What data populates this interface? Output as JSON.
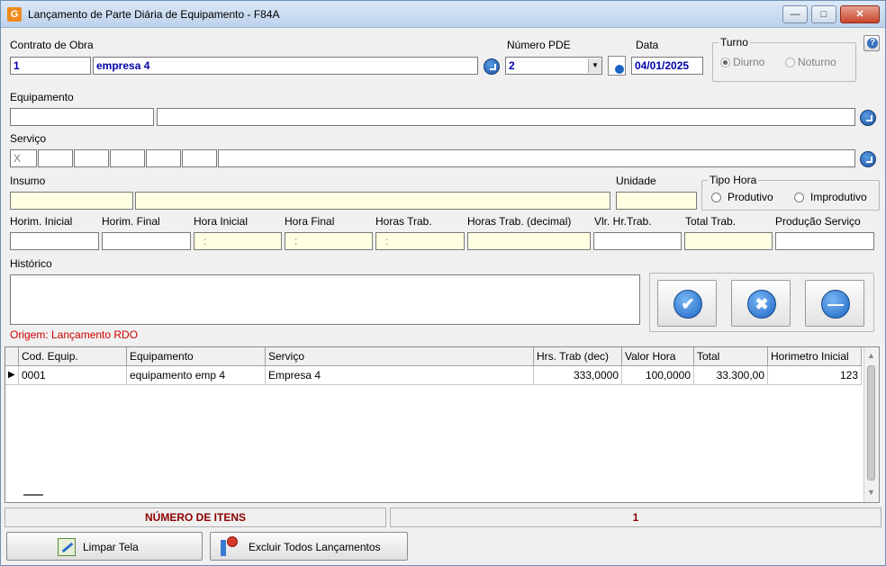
{
  "window": {
    "title": "Lançamento de Parte Diária de Equipamento - F84A",
    "app_icon": "G",
    "controls": {
      "minimize": "—",
      "maximize": "□",
      "close": "✕"
    }
  },
  "header": {
    "contrato_label": "Contrato de Obra",
    "contrato_code": "1",
    "contrato_name": "empresa 4",
    "numero_pde_label": "Número PDE",
    "numero_pde_value": "2",
    "data_label": "Data",
    "data_value": "04/01/2025",
    "turno": {
      "title": "Turno",
      "options": [
        "Diurno",
        "Noturno"
      ],
      "selected": "Diurno"
    }
  },
  "equipamento": {
    "label": "Equipamento",
    "code": "",
    "name": ""
  },
  "servico": {
    "label": "Serviço",
    "first_value": "X"
  },
  "insumo": {
    "label": "Insumo",
    "unidade_label": "Unidade",
    "tipo_hora": {
      "title": "Tipo Hora",
      "options": [
        "Produtivo",
        "Improdutivo"
      ]
    }
  },
  "hours": {
    "labels": [
      "Horim. Inicial",
      "Horim. Final",
      "Hora Inicial",
      "Hora Final",
      "Horas Trab.",
      "Horas Trab. (decimal)",
      "Vlr. Hr.Trab.",
      "Total Trab.",
      "Produção Serviço"
    ],
    "time_placeholder": ":"
  },
  "historico": {
    "label": "Histórico",
    "origem": "Origem: Lançamento RDO"
  },
  "grid": {
    "columns": [
      "Cod. Equip.",
      "Equipamento",
      "Serviço",
      "Hrs. Trab (dec)",
      "Valor Hora",
      "Total",
      "Horimetro Inicial"
    ],
    "rows": [
      [
        "0001",
        "equipamento emp 4",
        "Empresa 4",
        "333,0000",
        "100,0000",
        "33.300,00",
        "123"
      ]
    ]
  },
  "status": {
    "label": "NÚMERO DE ITENS",
    "count": "1"
  },
  "buttons": {
    "limpar": "Limpar Tela",
    "excluir": "Excluir Todos Lançamentos",
    "confirm_glyph": "✔",
    "cancel_glyph": "✖",
    "remove_glyph": "—"
  },
  "colors": {
    "accent_blue": "#1a63c2",
    "origin_red": "#d00000",
    "status_red": "#8b0000",
    "yellow_field": "#ffffe1"
  }
}
